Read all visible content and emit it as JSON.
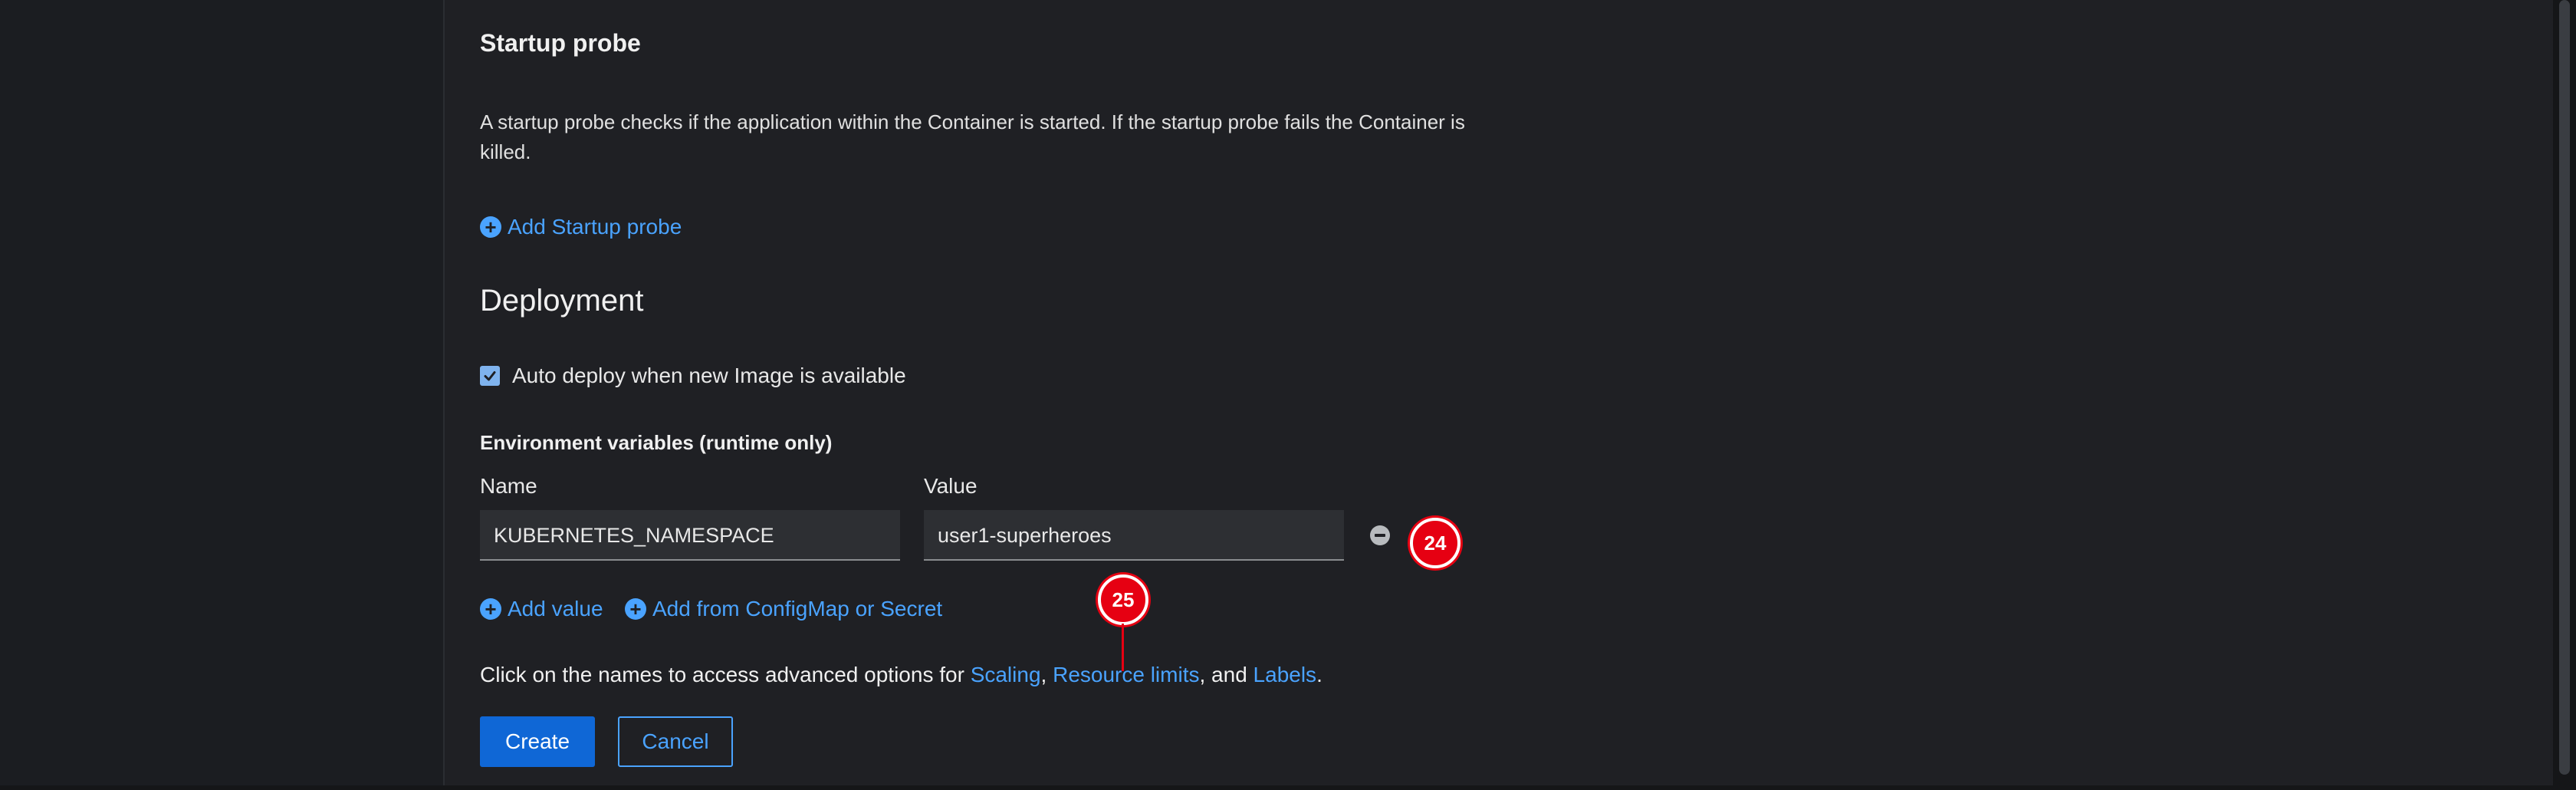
{
  "startup_probe": {
    "title": "Startup probe",
    "description": "A startup probe checks if the application within the Container is started. If the startup probe fails the Container is killed.",
    "add_label": "Add Startup probe"
  },
  "deployment": {
    "title": "Deployment",
    "auto_deploy_label": "Auto deploy when new Image is available",
    "auto_deploy_checked": true
  },
  "env": {
    "title": "Environment variables (runtime only)",
    "name_label": "Name",
    "value_label": "Value",
    "rows": [
      {
        "name": "KUBERNETES_NAMESPACE",
        "value": "user1-superheroes"
      }
    ],
    "add_value_label": "Add value",
    "add_from_label": "Add from ConfigMap or Secret"
  },
  "advanced": {
    "prefix": "Click on the names to access advanced options for ",
    "scaling": "Scaling",
    "sep1": ", ",
    "resource_limits": "Resource limits",
    "sep2": ", and ",
    "labels": "Labels",
    "suffix": "."
  },
  "actions": {
    "create_label": "Create",
    "cancel_label": "Cancel"
  },
  "markers": {
    "m24": "24",
    "m25": "25"
  },
  "colors": {
    "accent_link": "#4aa3ff",
    "primary_button": "#0f67d6",
    "marker_red": "#e60012"
  }
}
